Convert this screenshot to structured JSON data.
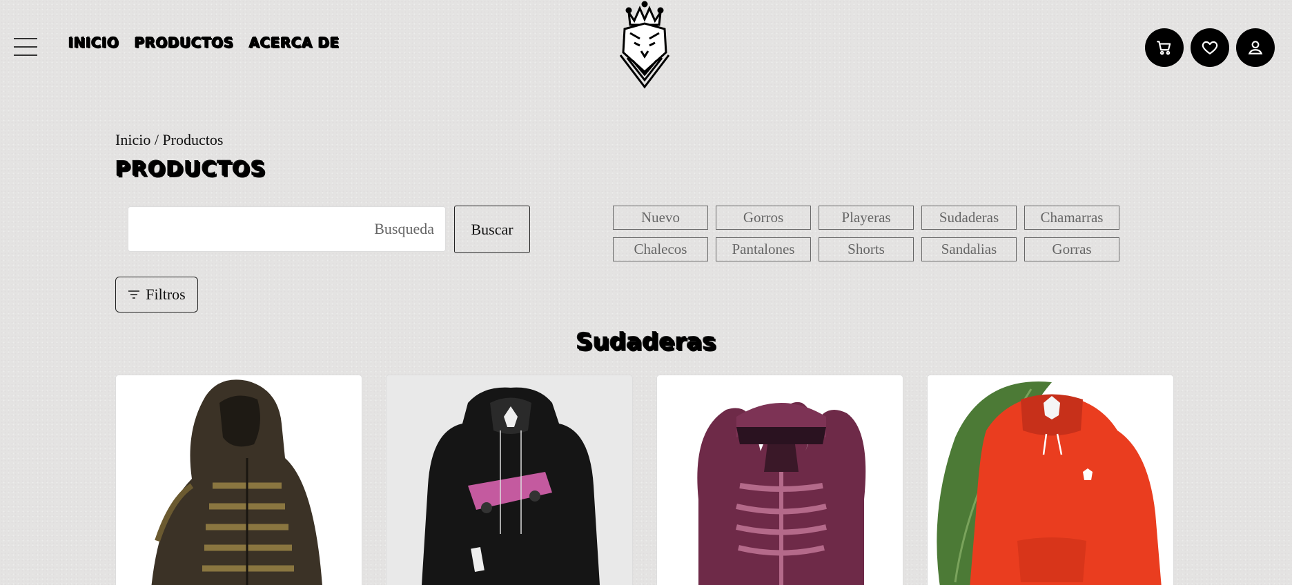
{
  "header": {
    "nav": [
      "INICIO",
      "PRODUCTOS",
      "ACERCA DE"
    ],
    "icons": [
      "cart-icon",
      "heart-icon",
      "user-icon"
    ]
  },
  "breadcrumb": "Inicio / Productos",
  "page_title": "PRODUCTOS",
  "search": {
    "placeholder": "Busqueda",
    "value": "",
    "button": "Buscar"
  },
  "categories": [
    "Nuevo",
    "Gorros",
    "Playeras",
    "Sudaderas",
    "Chamarras",
    "Chalecos",
    "Pantalones",
    "Shorts",
    "Sandalias",
    "Gorras"
  ],
  "filters_label": "Filtros",
  "section_title": "Sudaderas",
  "products": [
    {
      "image": "camo-skeleton-hoodie"
    },
    {
      "image": "black-hoodie-lowrider-car"
    },
    {
      "image": "maroon-skeleton-hoodie"
    },
    {
      "image": "red-hoodie-logo"
    }
  ]
}
